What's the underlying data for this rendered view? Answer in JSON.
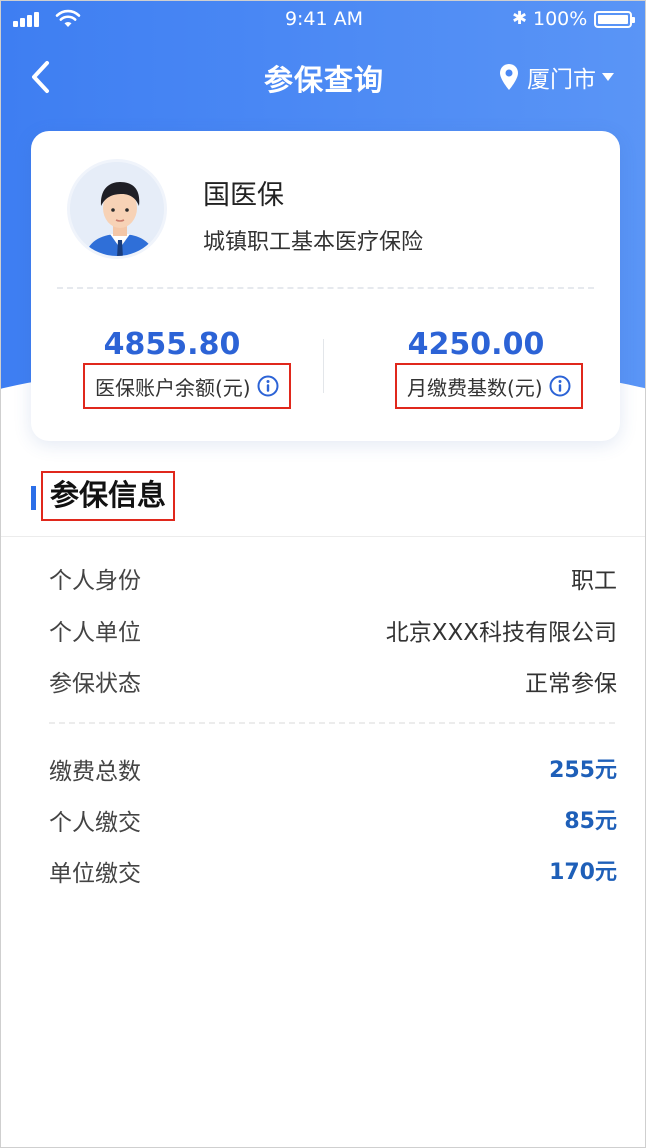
{
  "status_bar": {
    "time": "9:41 AM",
    "bluetooth_icon": "bluetooth-icon",
    "battery": "100%"
  },
  "nav": {
    "title": "参保查询",
    "city": "厦门市",
    "back_icon": "chevron-left-icon",
    "location_icon": "map-pin-icon"
  },
  "card": {
    "name": "国医保",
    "plan": "城镇职工基本医疗保险",
    "balance_value": "4855.80",
    "balance_label": "医保账户余额(元)",
    "base_value": "4250.00",
    "base_label": "月缴费基数(元)"
  },
  "section": {
    "title": "参保信息"
  },
  "info_rows": [
    {
      "key": "个人身份",
      "value": "职工"
    },
    {
      "key": "个人单位",
      "value": "北京XXX科技有限公司"
    },
    {
      "key": "参保状态",
      "value": "正常参保"
    }
  ],
  "payment_rows": [
    {
      "key": "缴费总数",
      "value": "255元"
    },
    {
      "key": "个人缴交",
      "value": "85元"
    },
    {
      "key": "单位缴交",
      "value": "170元"
    }
  ],
  "colors": {
    "header_start": "#3e7ef2",
    "header_end": "#5a95f6",
    "accent_blue": "#2c63d6",
    "highlight_red": "#e0281c"
  }
}
